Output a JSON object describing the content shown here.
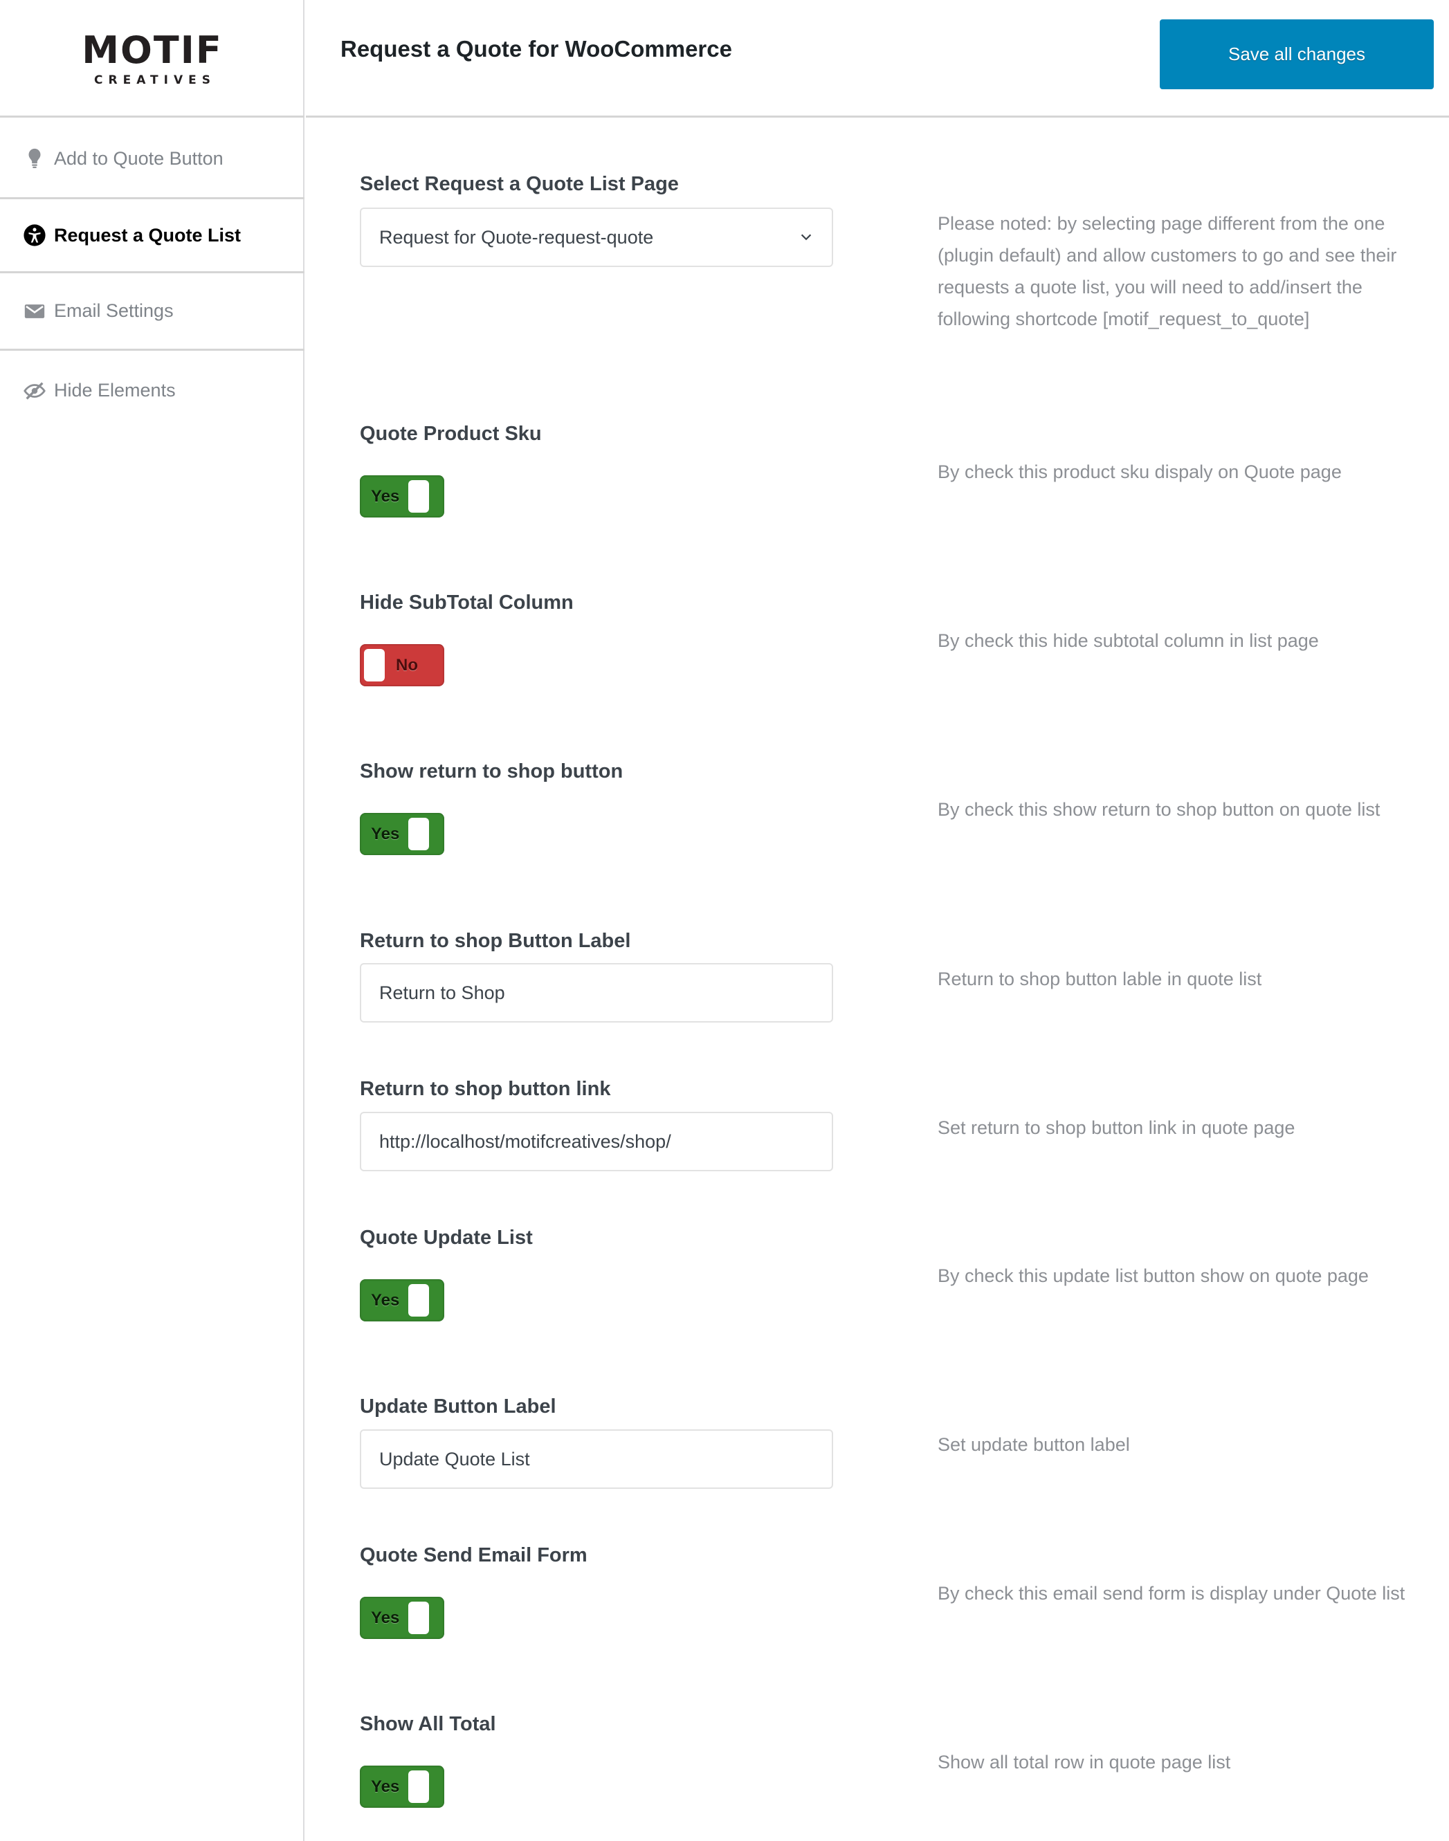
{
  "brand": {
    "logo_main": "MOTIF",
    "logo_sub": "CREATIVES"
  },
  "header": {
    "title": "Request a Quote for WooCommerce",
    "save_label": "Save all changes",
    "save_color": "#0085ba"
  },
  "sidebar": {
    "items": [
      {
        "label": "Add to Quote Button",
        "icon": "lightbulb-icon",
        "active": false
      },
      {
        "label": "Request a Quote List",
        "icon": "accessibility-icon",
        "active": true
      },
      {
        "label": "Email Settings",
        "icon": "envelope-icon",
        "active": false
      },
      {
        "label": "Hide Elements",
        "icon": "eye-slash-icon",
        "active": false
      }
    ]
  },
  "settings": {
    "quote_list_page": {
      "label": "Select Request a Quote List Page",
      "selected": "Request for Quote-request-quote",
      "help": "Please noted: by selecting page different from the one (plugin default) and allow customers to go and see their requests a quote list, you will need to add/insert the following shortcode [motif_request_to_quote]"
    },
    "product_sku": {
      "label": "Quote Product Sku",
      "state": "Yes",
      "enabled": true,
      "help": "By check this product sku dispaly on Quote page"
    },
    "hide_subtotal": {
      "label": "Hide SubTotal Column",
      "state": "No",
      "enabled": false,
      "help": "By check this hide subtotal column in list page"
    },
    "return_shop_button": {
      "label": "Show return to shop button",
      "state": "Yes",
      "enabled": true,
      "help": "By check this show return to shop button on quote list"
    },
    "return_shop_label": {
      "label": "Return to shop Button Label",
      "value": "Return to Shop",
      "help": "Return to shop button lable in quote list"
    },
    "return_shop_link": {
      "label": "Return to shop button link",
      "value": "http://localhost/motifcreatives/shop/",
      "help": "Set return to shop button link in quote page"
    },
    "update_list": {
      "label": "Quote Update List",
      "state": "Yes",
      "enabled": true,
      "help": "By check this update list button show on quote page"
    },
    "update_button_label": {
      "label": "Update Button Label",
      "value": "Update Quote List",
      "help": "Set update button label"
    },
    "send_email_form": {
      "label": "Quote Send Email Form",
      "state": "Yes",
      "enabled": true,
      "help": "By check this email send form is display under Quote list"
    },
    "show_all_total": {
      "label": "Show All Total",
      "state": "Yes",
      "enabled": true,
      "help": "Show all total row in quote page list"
    }
  },
  "colors": {
    "toggle_on": "#378a2e",
    "toggle_off": "#cc3a3a"
  }
}
